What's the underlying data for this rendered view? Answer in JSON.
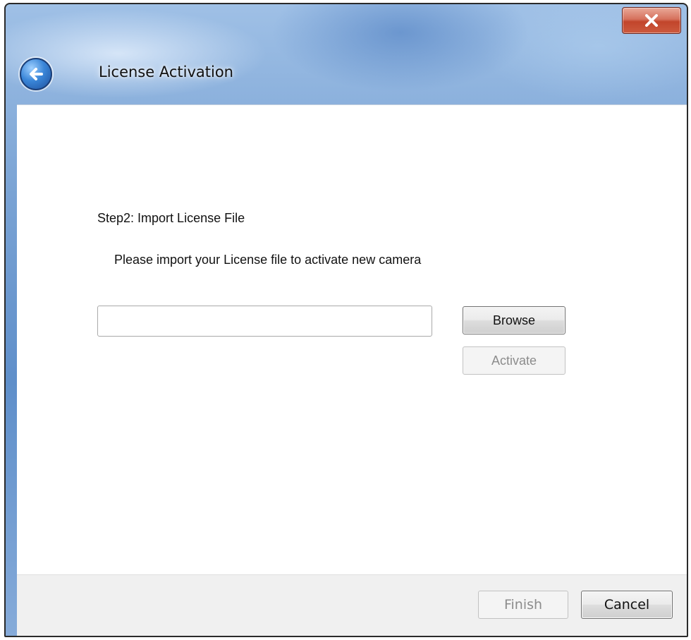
{
  "window": {
    "title": "License Activation",
    "close_icon": "close-icon",
    "back_icon": "back-arrow-icon"
  },
  "step": {
    "heading": "Step2: Import License File",
    "instructions": "Please import your License file to activate new camera"
  },
  "file_input": {
    "value": "",
    "placeholder": ""
  },
  "buttons": {
    "browse": "Browse",
    "activate": "Activate",
    "finish": "Finish",
    "cancel": "Cancel"
  },
  "colors": {
    "close_button": "#c94a30",
    "title_bar": "#6f9ad0",
    "footer": "#f0f0f0",
    "disabled_text": "#8c8c8c"
  }
}
